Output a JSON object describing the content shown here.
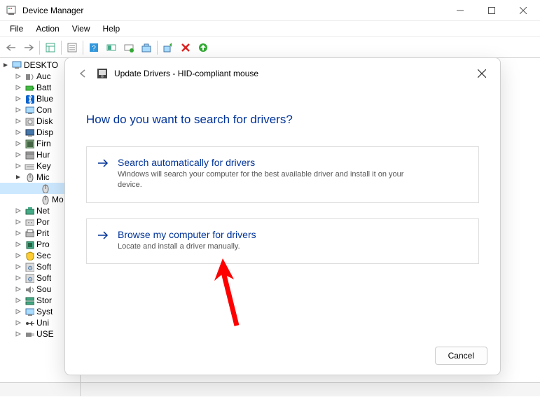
{
  "window": {
    "title": "Device Manager"
  },
  "menu": {
    "file": "File",
    "action": "Action",
    "view": "View",
    "help": "Help"
  },
  "tree": {
    "root": "DESKTO",
    "items": [
      {
        "label": "Auc",
        "icon": "audio"
      },
      {
        "label": "Batt",
        "icon": "battery"
      },
      {
        "label": "Blue",
        "icon": "bluetooth"
      },
      {
        "label": "Con",
        "icon": "computer"
      },
      {
        "label": "Disk",
        "icon": "disk"
      },
      {
        "label": "Disp",
        "icon": "display"
      },
      {
        "label": "Firn",
        "icon": "firmware"
      },
      {
        "label": "Hur",
        "icon": "hid"
      },
      {
        "label": "Key",
        "icon": "keyboard"
      },
      {
        "label": "Mic",
        "icon": "mouse",
        "expanded": true,
        "children": [
          {
            "label": "",
            "sel": true
          },
          {
            "label": "Mo"
          }
        ]
      },
      {
        "label": "Net",
        "icon": "network"
      },
      {
        "label": "Por",
        "icon": "ports"
      },
      {
        "label": "Prit",
        "icon": "print"
      },
      {
        "label": "Pro",
        "icon": "processor"
      },
      {
        "label": "Sec",
        "icon": "security"
      },
      {
        "label": "Soft",
        "icon": "software"
      },
      {
        "label": "Soft",
        "icon": "software"
      },
      {
        "label": "Sou",
        "icon": "sound"
      },
      {
        "label": "Stor",
        "icon": "storage"
      },
      {
        "label": "Syst",
        "icon": "system"
      },
      {
        "label": "Uni",
        "icon": "usb"
      },
      {
        "label": "USE",
        "icon": "usb-connector"
      }
    ]
  },
  "dialog": {
    "title": "Update Drivers - HID-compliant mouse",
    "heading": "How do you want to search for drivers?",
    "option1": {
      "title": "Search automatically for drivers",
      "sub": "Windows will search your computer for the best available driver and install it on your device."
    },
    "option2": {
      "title": "Browse my computer for drivers",
      "sub": "Locate and install a driver manually."
    },
    "cancel": "Cancel"
  }
}
